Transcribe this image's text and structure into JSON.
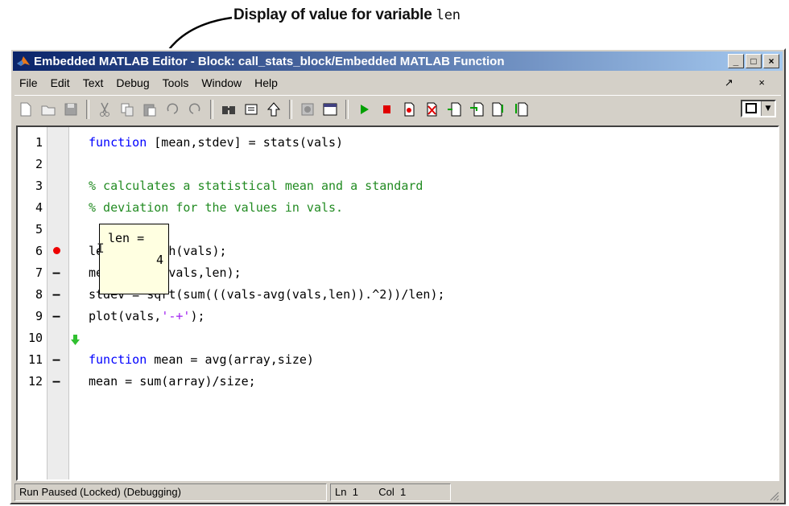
{
  "annotation": {
    "text": "Display of value for variable",
    "variable": "len"
  },
  "window": {
    "title": "Embedded MATLAB Editor - Block: call_stats_block/Embedded MATLAB Function",
    "controls": [
      "_",
      "□",
      "×"
    ]
  },
  "menu": {
    "items": [
      "File",
      "Edit",
      "Text",
      "Debug",
      "Tools",
      "Window",
      "Help"
    ],
    "right": "↗ ×"
  },
  "toolbar": {
    "icons": [
      "new-icon",
      "open-icon",
      "save-icon",
      "cut-icon",
      "copy-icon",
      "paste-icon",
      "undo-icon",
      "redo-icon",
      "find-icon",
      "show-icon",
      "up-icon",
      "compile-icon",
      "debug-icon",
      "run-icon",
      "stop-icon",
      "set-breakpoint-icon",
      "clear-breakpoints-icon",
      "step-icon",
      "step-in-icon",
      "step-out-icon",
      "step-down-icon"
    ]
  },
  "editor": {
    "lines": [
      {
        "num": "1",
        "marker": "",
        "breakpoint": false
      },
      {
        "num": "2",
        "marker": "",
        "breakpoint": false
      },
      {
        "num": "3",
        "marker": "",
        "breakpoint": false
      },
      {
        "num": "4",
        "marker": "",
        "breakpoint": false
      },
      {
        "num": "5",
        "marker": "",
        "breakpoint": false
      },
      {
        "num": "6",
        "marker": "",
        "breakpoint": true
      },
      {
        "num": "7",
        "marker": "–",
        "breakpoint": false
      },
      {
        "num": "8",
        "marker": "–",
        "breakpoint": false
      },
      {
        "num": "9",
        "marker": "–",
        "breakpoint": false
      },
      {
        "num": "10",
        "marker": "",
        "breakpoint": false
      },
      {
        "num": "11",
        "marker": "–",
        "breakpoint": false
      },
      {
        "num": "12",
        "marker": "–",
        "breakpoint": false
      }
    ],
    "code": {
      "l1_kw": "function",
      "l1_rest": " [mean,stdev] = stats(vals)",
      "l3": "% calculates a statistical mean and a standard",
      "l4": "% deviation for the values in vals.",
      "l6": "len = length(vals);",
      "l7": "mean = avg(vals,len);",
      "l8": "stdev = sqrt(sum(((vals-avg(vals,len)).^2))/len);",
      "l9_a": "plot(vals,",
      "l9_str": "'-+'",
      "l9_b": ");",
      "l11_kw": "function",
      "l11_rest": " mean = avg(array,size)",
      "l12": "mean = sum(array)/size;"
    },
    "tooltip": {
      "name": "len =",
      "value": "4"
    }
  },
  "status": {
    "message": "Run Paused (Locked) (Debugging)",
    "ln_label": "Ln",
    "ln_value": "1",
    "col_label": "Col",
    "col_value": "1"
  },
  "colors": {
    "keyword": "#0000ff",
    "comment": "#228b22",
    "string": "#a020f0",
    "breakpoint": "#ee0000",
    "tooltip_bg": "#ffffe1"
  }
}
